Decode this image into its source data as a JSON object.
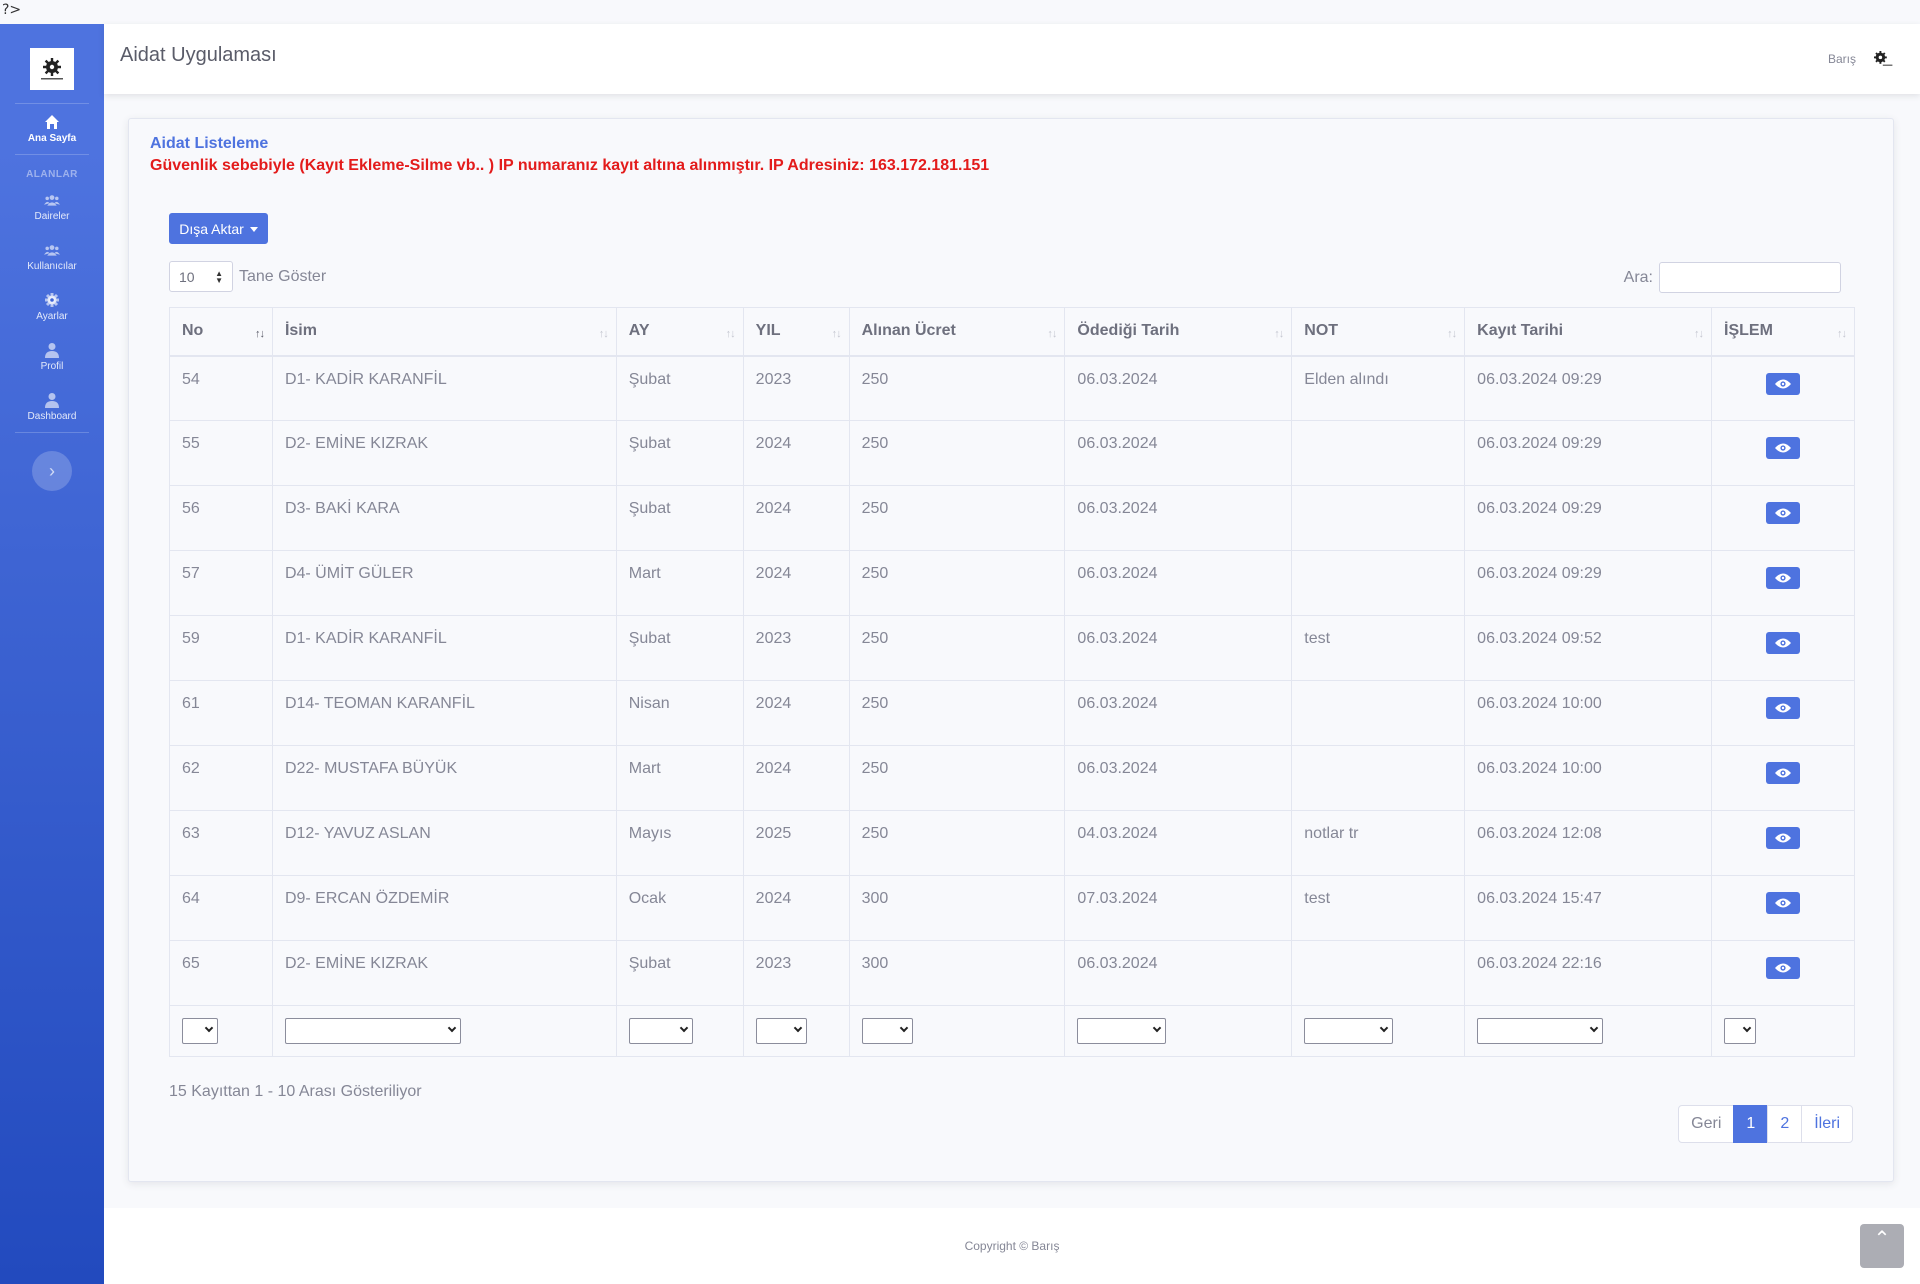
{
  "stray_text": "?>",
  "app": {
    "title": "Aidat Uygulaması"
  },
  "user": {
    "name": "Barış"
  },
  "sidebar": {
    "home_label": "Ana Sayfa",
    "heading": "ALANLAR",
    "items": [
      {
        "label": "Daireler",
        "icon": "users-icon"
      },
      {
        "label": "Kullanıcılar",
        "icon": "users-icon"
      },
      {
        "label": "Ayarlar",
        "icon": "gear-icon"
      },
      {
        "label": "Profil",
        "icon": "user-icon"
      },
      {
        "label": "Dashboard",
        "icon": "user-icon"
      }
    ],
    "toggle_glyph": "›"
  },
  "card": {
    "title": "Aidat Listeleme",
    "warning": "Güvenlik sebebiyle (Kayıt Ekleme-Silme vb.. ) IP numaranız kayıt altına alınmıştır. IP Adresiniz: 163.172.181.151"
  },
  "toolbar": {
    "export_label": "Dışa Aktar",
    "length_value": "10",
    "length_suffix": "Tane Göster",
    "search_label": "Ara:",
    "search_value": ""
  },
  "table": {
    "columns": [
      "No",
      "İsim",
      "AY",
      "YIL",
      "Alınan Ücret",
      "Ödediği Tarih",
      "NOT",
      "Kayıt Tarihi",
      "İŞLEM"
    ],
    "rows": [
      [
        "54",
        "D1- KADİR KARANFİL",
        "Şubat",
        "2023",
        "250",
        "06.03.2024",
        "Elden alındı",
        "06.03.2024 09:29"
      ],
      [
        "55",
        "D2- EMİNE KIZRAK",
        "Şubat",
        "2024",
        "250",
        "06.03.2024",
        "",
        "06.03.2024 09:29"
      ],
      [
        "56",
        "D3- BAKİ KARA",
        "Şubat",
        "2024",
        "250",
        "06.03.2024",
        "",
        "06.03.2024 09:29"
      ],
      [
        "57",
        "D4- ÜMİT GÜLER",
        "Mart",
        "2024",
        "250",
        "06.03.2024",
        "",
        "06.03.2024 09:29"
      ],
      [
        "59",
        "D1- KADİR KARANFİL",
        "Şubat",
        "2023",
        "250",
        "06.03.2024",
        "test",
        "06.03.2024 09:52"
      ],
      [
        "61",
        "D14- TEOMAN KARANFİL",
        "Nisan",
        "2024",
        "250",
        "06.03.2024",
        "",
        "06.03.2024 10:00"
      ],
      [
        "62",
        "D22- MUSTAFA BÜYÜK",
        "Mart",
        "2024",
        "250",
        "06.03.2024",
        "",
        "06.03.2024 10:00"
      ],
      [
        "63",
        "D12- YAVUZ ASLAN",
        "Mayıs",
        "2025",
        "250",
        "04.03.2024",
        "notlar tr",
        "06.03.2024 12:08"
      ],
      [
        "64",
        "D9- ERCAN ÖZDEMİR",
        "Ocak",
        "2024",
        "300",
        "07.03.2024",
        "test",
        "06.03.2024 15:47"
      ],
      [
        "65",
        "D2- EMİNE KIZRAK",
        "Şubat",
        "2023",
        "300",
        "06.03.2024",
        "",
        "06.03.2024 22:16"
      ]
    ]
  },
  "pagination": {
    "info": "15 Kayıttan 1 - 10 Arası Gösteriliyor",
    "prev": "Geri",
    "pages": [
      "1",
      "2"
    ],
    "current": "1",
    "next": "İleri"
  },
  "footer": {
    "copyright": "Copyright © Barış"
  },
  "colors": {
    "primary": "#4e73df",
    "sidebar_end": "#224abe",
    "warning": "#e31b1b",
    "text": "#858796"
  }
}
